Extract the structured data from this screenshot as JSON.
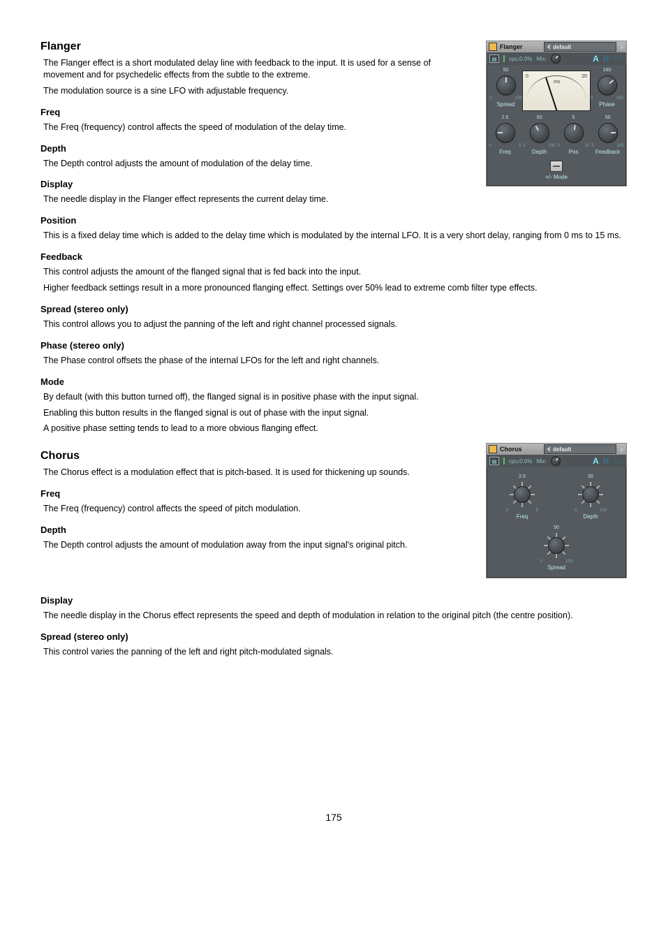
{
  "page_number": "175",
  "flanger": {
    "heading": "Flanger",
    "intro_1": "The Flanger effect is a short modulated delay line with feedback to the input. It is used for a sense of movement and for psychedelic effects from the subtle to the extreme.",
    "intro_2": "The modulation source is a sine LFO with adjustable frequency.",
    "freq_h": "Freq",
    "freq_p": "The Freq (frequency) control affects the speed of modulation of the delay time.",
    "depth_h": "Depth",
    "depth_p": "The Depth control adjusts the amount of modulation of the delay time.",
    "display_h": "Display",
    "display_p": "The needle display in the Flanger effect represents the current delay time.",
    "position_h": "Position",
    "position_p": "This is a fixed delay time which is added to the delay time which is modulated by the internal LFO. It is a very short delay, ranging from 0 ms to 15 ms.",
    "feedback_h": "Feedback",
    "feedback_p1": "This control adjusts the amount of the flanged signal that is fed back into the input.",
    "feedback_p2": "Higher feedback settings result in a more pronounced flanging effect. Settings over 50% lead to extreme comb filter type effects.",
    "spread_h": "Spread (stereo only)",
    "spread_p": "This control allows you to adjust the panning of the left and right channel processed signals.",
    "phase_h": "Phase (stereo only)",
    "phase_p": "The Phase control offsets the phase of the internal LFOs for the left and right channels.",
    "mode_h": "Mode",
    "mode_p1": "By default (with this button turned off), the flanged signal is in positive phase with the input signal.",
    "mode_p2": "Enabling this button results in the flanged signal is out of phase with the input signal.",
    "mode_p3": "A positive phase setting tends to lead to a more obvious flanging effect."
  },
  "chorus": {
    "heading": "Chorus",
    "intro_1": "The Chorus effect is a modulation effect that is pitch-based. It is used for thickening up sounds.",
    "freq_h": "Freq",
    "freq_p": "The Freq (frequency) control affects the speed of pitch modulation.",
    "depth_h": "Depth",
    "depth_p": "The Depth control adjusts the amount of modulation away from the input signal's original pitch.",
    "display_h": "Display",
    "display_p": "The needle display in the Chorus effect represents the speed and depth of modulation in relation to the original pitch (the centre position).",
    "spread_h": "Spread (stereo only)",
    "spread_p": "This control varies the panning of the left and right pitch-modulated signals."
  },
  "flanger_panel": {
    "name": "Flanger",
    "preset": "default",
    "cpu": "cpu:0.0%",
    "mix": "Mix:",
    "ab_a": "A",
    "ab_b": "B",
    "sc": "SC",
    "spread": {
      "label": "Spread",
      "top": "50",
      "min": "0",
      "max": "100"
    },
    "phase": {
      "label": "Phase",
      "top": "180",
      "min": "0",
      "max": "360"
    },
    "meter": {
      "min": "0",
      "max": "20",
      "unit": "ms"
    },
    "freq": {
      "label": "Freq",
      "top": "2.5",
      "min": "0",
      "max": "5"
    },
    "depth": {
      "label": "Depth",
      "top": "50",
      "min": "0",
      "max": "100"
    },
    "pos": {
      "label": "Pos",
      "top": "5",
      "min": "0",
      "max": "10"
    },
    "fback": {
      "label": "Feedback",
      "top": "50",
      "min": "0",
      "max": "100"
    },
    "mode_label": "+/- Mode"
  },
  "chorus_panel": {
    "name": "Chorus",
    "preset": "default",
    "cpu": "cpu:0.0%",
    "mix": "Mix:",
    "ab_a": "A",
    "ab_b": "B",
    "sc": "SC",
    "freq": {
      "label": "Freq",
      "top": "2.5",
      "min": "0",
      "max": "5"
    },
    "depth": {
      "label": "Depth",
      "top": "50",
      "min": "0",
      "max": "100"
    },
    "spread": {
      "label": "Spread",
      "top": "50",
      "min": "0",
      "max": "100"
    }
  }
}
